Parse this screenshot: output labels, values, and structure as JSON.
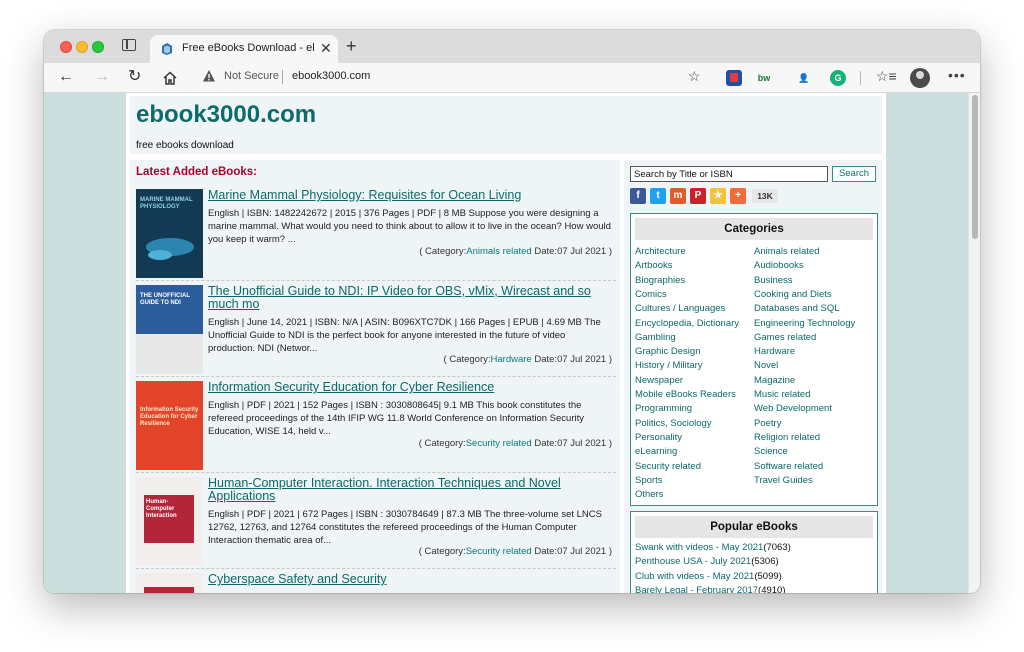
{
  "browser": {
    "tab_title": "Free eBooks Download - ebook",
    "address_security": "Not Secure",
    "address_url": "ebook3000.com",
    "extensions": [
      {
        "name": "ext-red-icon",
        "label": "",
        "color": "#1f4fa8"
      },
      {
        "name": "ext-bw-icon",
        "label": "bw",
        "color": "#1a7a2a"
      },
      {
        "name": "ext-person-icon",
        "label": "",
        "color": "#2a62c8"
      },
      {
        "name": "ext-grammarly-icon",
        "label": "G",
        "color": "#15b27a"
      }
    ]
  },
  "site": {
    "title": "ebook3000.com",
    "tagline": "free ebooks download"
  },
  "latest": {
    "heading": "Latest Added eBooks:",
    "books": [
      {
        "title": "Marine Mammal Physiology: Requisites for Ocean Living",
        "desc": "English | ISBN: 1482242672 | 2015 | 376 Pages | PDF | 8 MB Suppose you were designing a marine mammal. What would you need to think about to allow it to live in the ocean? How would you keep it warm? ...",
        "meta_prefix": "( Category:",
        "category": "Animals related",
        "meta_suffix": " Date:07 Jul 2021 )",
        "cover_text": "MARINE MAMMAL PHYSIOLOGY",
        "cover_bg": "#123a52",
        "cover_fg": "#8fd0e8"
      },
      {
        "title": "The Unofficial Guide to NDI: IP Video for OBS, vMix, Wirecast and so much mo",
        "desc": "English | June 14, 2021 | ISBN: N/A | ASIN: B096XTC7DK | 166 Pages | EPUB | 4.69 MB The Unofficial Guide to NDI is the perfect book for anyone interested in the future of video production. NDI (Networ...",
        "meta_prefix": "( Category:",
        "category": "Hardware",
        "meta_suffix": " Date:07 Jul 2021 )",
        "cover_text": "THE UNOFFICIAL GUIDE TO NDI",
        "cover_bg": "#2b5d9c",
        "cover_fg": "#ffffff"
      },
      {
        "title": "Information Security Education for Cyber Resilience",
        "desc": "English | PDF | 2021 | 152 Pages | ISBN : 3030808645| 9.1 MB This book constitutes the refereed proceedings of the 14th IFIP WG 11.8 World Conference on Information Security Education, WISE 14, held v...",
        "meta_prefix": "( Category:",
        "category": "Security related",
        "meta_suffix": " Date:07 Jul 2021 )",
        "cover_text": "Information Security Education for Cyber Resilience",
        "cover_bg": "#e2452a",
        "cover_fg": "#ffe6c8"
      },
      {
        "title": "Human-Computer Interaction. Interaction Techniques and Novel Applications",
        "desc": "English | PDF | 2021 | 672 Pages | ISBN : 3030784649 | 87.3 MB The three-volume set LNCS 12762, 12763, and 12764 constitutes the refereed proceedings of the Human Computer Interaction thematic area of...",
        "meta_prefix": "( Category:",
        "category": "Security related",
        "meta_suffix": " Date:07 Jul 2021 )",
        "cover_text": "Human-Computer Interaction",
        "cover_bg": "#b3263a",
        "cover_fg": "#ffffff"
      },
      {
        "title": "Cyberspace Safety and Security",
        "desc": "",
        "meta_prefix": "",
        "category": "",
        "meta_suffix": "",
        "cover_text": "",
        "cover_bg": "#b3263a",
        "cover_fg": "#ffffff"
      }
    ]
  },
  "search": {
    "value": "Search by Title or ISBN",
    "button": "Search"
  },
  "share": {
    "count": "13K"
  },
  "categories": {
    "heading": "Categories",
    "col1": [
      "Architecture",
      "Artbooks",
      "Biographies",
      "Comics",
      "Cultures / Languages",
      "Encyclopedia, Dictionary",
      "Gambling",
      "Graphic Design",
      "History / Military",
      "Newspaper",
      "Mobile eBooks Readers",
      "Programming",
      "Politics, Sociology",
      "Personality",
      "eLearning",
      "Security related",
      "Sports",
      "Others"
    ],
    "col2": [
      "Animals related",
      "Audiobooks",
      "Business",
      "Cooking and Diets",
      "Databases and SQL",
      "Engineering Technology",
      "Games related",
      "Hardware",
      "Novel",
      "Magazine",
      "Music related",
      "Web Development",
      "Poetry",
      "Religion related",
      "Science",
      "Software related",
      "Travel Guides"
    ]
  },
  "popular": {
    "heading": "Popular eBooks",
    "items": [
      {
        "title": "Swank with videos - May 2021",
        "count": "(7063)"
      },
      {
        "title": "Penthouse USA - July 2021",
        "count": "(5306)"
      },
      {
        "title": "Club with videos - May 2021",
        "count": "(5099)"
      },
      {
        "title": "Barely Legal - February 2017",
        "count": "(4910)"
      }
    ]
  }
}
